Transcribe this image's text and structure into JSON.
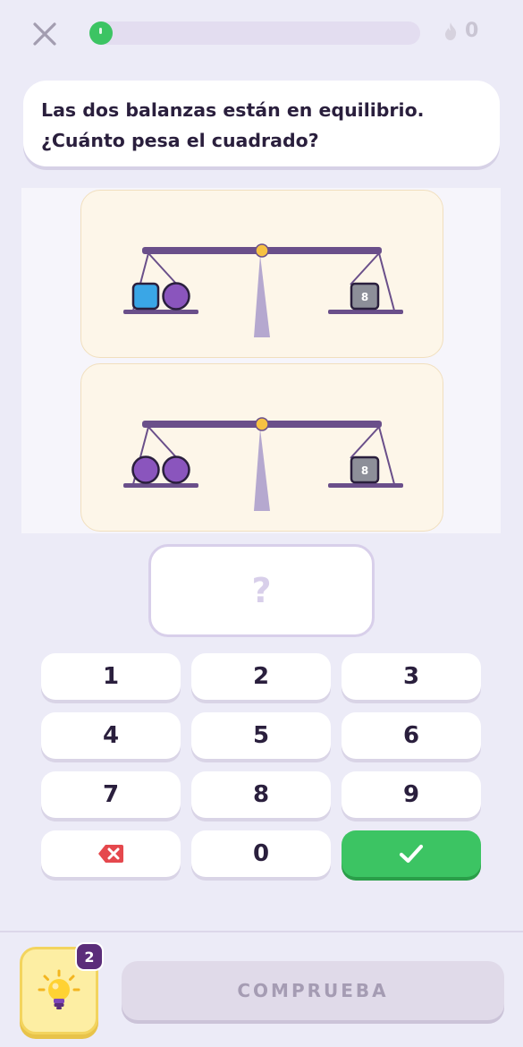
{
  "header": {
    "close_icon": "close-icon",
    "progress": 0.06,
    "streak_icon": "flame-icon",
    "streak_count": "0"
  },
  "question": {
    "text_before": "Las dos balanzas están en equilibrio. ¿Cuánto pesa el ",
    "text_bold": "cuadrado",
    "text_after": "?"
  },
  "scales": [
    {
      "left_items": [
        "square",
        "circle"
      ],
      "right_weight_label": "8"
    },
    {
      "left_items": [
        "circle",
        "circle"
      ],
      "right_weight_label": "8"
    }
  ],
  "answer": {
    "placeholder": "?"
  },
  "keypad": {
    "keys": [
      "1",
      "2",
      "3",
      "4",
      "5",
      "6",
      "7",
      "8",
      "9"
    ],
    "zero": "0",
    "delete_icon": "backspace-icon",
    "confirm_icon": "check-icon"
  },
  "colors": {
    "accent_green": "#3cc463",
    "purple": "#6a4f8a",
    "square_blue": "#3aa6e6",
    "circle_purple": "#8a55bd",
    "weight_grey": "#8d8f99"
  },
  "hint": {
    "icon": "lightbulb-icon",
    "count": "2"
  },
  "check_button": {
    "label": "COMPRUEBA"
  }
}
